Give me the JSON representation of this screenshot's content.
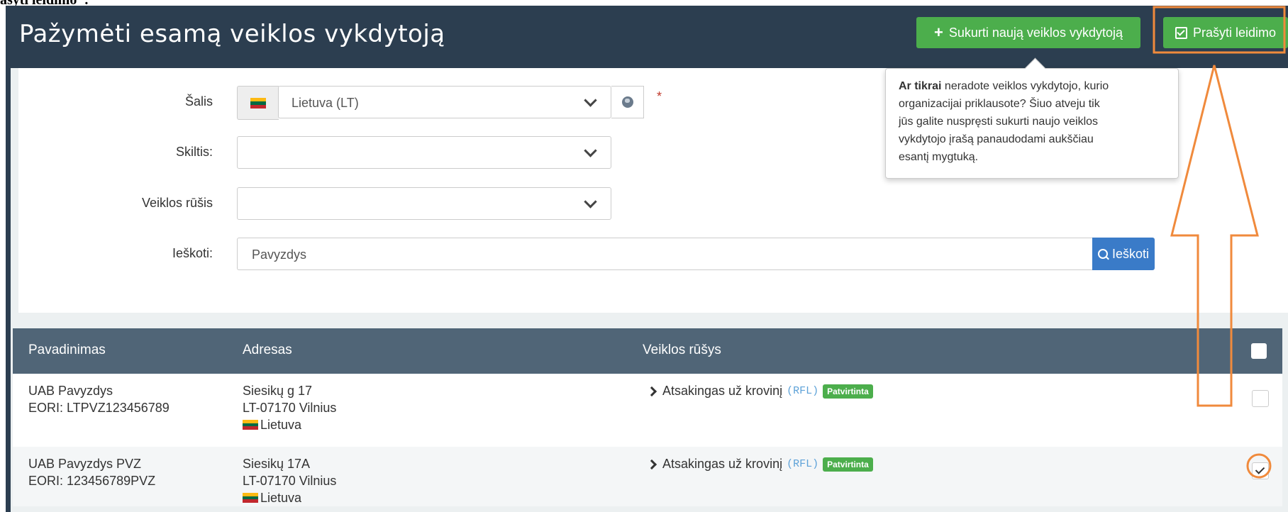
{
  "doc_fragment": "ašyti leidimo\".",
  "header": {
    "title": "Pažymėti esamą veiklos vykdytoją",
    "create_button_label": "Sukurti naują veiklos vykdytoją",
    "ask_button_label": "Prašyti leidimo"
  },
  "form": {
    "country_label": "Šalis",
    "country_value": "Lietuva (LT)",
    "required_mark": "*",
    "section_label": "Skiltis:",
    "section_value": "",
    "activity_label": "Veiklos rūšis",
    "activity_value": "",
    "search_label": "Ieškoti:",
    "search_value": "Pavyzdys",
    "search_button_label": "Ieškoti"
  },
  "tooltip": {
    "bold": "Ar tikrai",
    "line1_rest": " neradote veiklos vykdytojo, kurio",
    "line2": "organizacijai priklausote? Šiuo atveju tik",
    "line3": "jūs galite nuspręsti sukurti naujo veiklos",
    "line4": "vykdytojo įrašą panaudodami aukščiau",
    "line5": "esantį mygtuką."
  },
  "table": {
    "headers": [
      "Pavadinimas",
      "Adresas",
      "Veiklos rūšys"
    ],
    "rows": [
      {
        "name": "UAB Pavyzdys",
        "eori": "EORI: LTPVZ123456789",
        "street": "Siesikų g 17",
        "city": "LT-07170 Vilnius",
        "country": "Lietuva",
        "activity": "Atsakingas už krovinį",
        "code": "(RFL)",
        "status": "Patvirtinta",
        "checked": false
      },
      {
        "name": "UAB Pavyzdys PVZ",
        "eori": "EORI: 123456789PVZ",
        "street": "Siesikų 17A",
        "city": "LT-07170 Vilnius",
        "country": "Lietuva",
        "activity": "Atsakingas už krovinį",
        "code": "(RFL)",
        "status": "Patvirtinta",
        "checked": true
      }
    ]
  },
  "colors": {
    "header_bg": "#2c3e50",
    "success": "#4cae4c",
    "primary": "#3a7bc8",
    "annotation": "#f08a3c",
    "table_head": "#506577"
  },
  "icons": {
    "create": "plus-icon",
    "ask": "check-square-icon",
    "globe": "globe-icon",
    "search": "search-icon",
    "flag": "lithuania-flag-icon"
  }
}
